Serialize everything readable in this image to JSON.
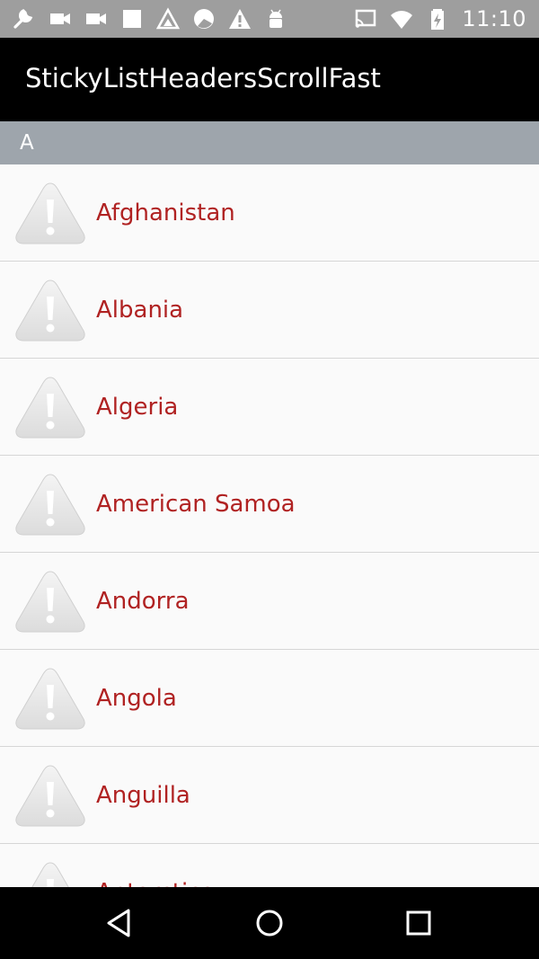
{
  "status_bar": {
    "time": "11:10",
    "left_icons": [
      "wrench-icon",
      "video-camera-icon",
      "video-camera-icon",
      "square-icon",
      "inverted-triangle-icon",
      "camera-lens-icon",
      "warning-icon",
      "android-icon"
    ],
    "right_icons": [
      "cast-icon",
      "wifi-icon",
      "battery-charging-icon"
    ]
  },
  "app_bar": {
    "title": "StickyListHeadersScrollFast"
  },
  "list": {
    "section_header": "A",
    "items": [
      {
        "label": "Afghanistan",
        "icon": "warning-icon"
      },
      {
        "label": "Albania",
        "icon": "warning-icon"
      },
      {
        "label": "Algeria",
        "icon": "warning-icon"
      },
      {
        "label": "American Samoa",
        "icon": "warning-icon"
      },
      {
        "label": "Andorra",
        "icon": "warning-icon"
      },
      {
        "label": "Angola",
        "icon": "warning-icon"
      },
      {
        "label": "Anguilla",
        "icon": "warning-icon"
      },
      {
        "label": "Antarctica",
        "icon": "warning-icon"
      }
    ]
  },
  "nav_bar": {
    "buttons": [
      "back-icon",
      "home-icon",
      "recents-icon"
    ]
  },
  "colors": {
    "status_bar": "#9e9e9e",
    "app_bar": "#000000",
    "header": "#9ea5ac",
    "item_text": "#b02222",
    "nav_bar": "#000000"
  }
}
